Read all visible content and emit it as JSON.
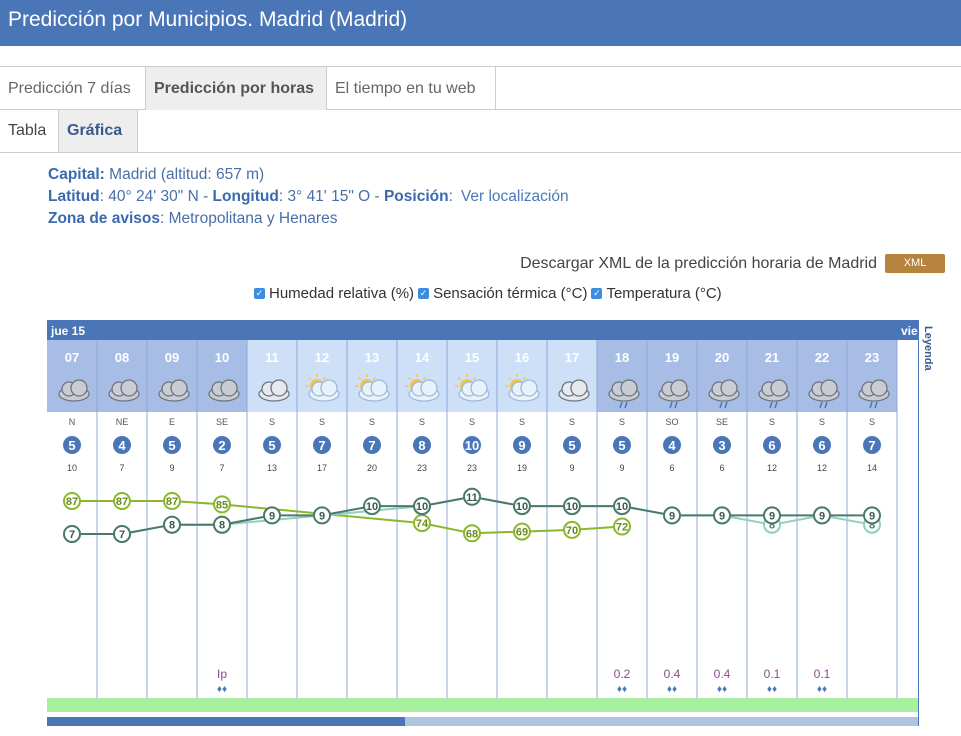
{
  "page": {
    "title": "Predicción por Municipios. Madrid (Madrid)"
  },
  "tabs": [
    "Predicción 7 días",
    "Predicción por horas",
    "El tiempo en tu web"
  ],
  "subtabs": [
    "Tabla",
    "Gráfica"
  ],
  "info": {
    "capital_label": "Capital:",
    "capital_value": "Madrid (altitud: 657 m)",
    "lat_label": "Latitud",
    "lat_value": ": 40° 24' 30\" N -",
    "lon_label": "Longitud",
    "lon_value": ": 3° 41' 15\" O -",
    "pos_label": "Posición",
    "pos_colon": ":",
    "pos_link": "Ver localización",
    "zona_label": "Zona de avisos",
    "zona_value": ": Metropolitana y Henares"
  },
  "xml": {
    "text": "Descargar XML de la predicción horaria de Madrid",
    "button": "XML"
  },
  "checkboxes": [
    "Humedad relativa (%)",
    "Sensación térmica (°C)",
    "Temperatura (°C)"
  ],
  "chart_labels": {
    "day1": "jue 15",
    "day2": "vie",
    "legend": "Leyenda"
  },
  "colors": {
    "header": "#4a76b8",
    "humidity": "#8ab82a",
    "feels": "#90d0c0",
    "temp": "#4a7a6a",
    "wind": "#4a76b8",
    "precip": "#8a4a8a"
  },
  "chart_data": {
    "type": "line",
    "x": [
      "07",
      "08",
      "09",
      "10",
      "11",
      "12",
      "13",
      "14",
      "15",
      "16",
      "17",
      "18",
      "19",
      "20",
      "21",
      "22",
      "23"
    ],
    "night": [
      true,
      true,
      true,
      true,
      false,
      false,
      false,
      false,
      false,
      false,
      false,
      true,
      true,
      true,
      true,
      true,
      true
    ],
    "sky": [
      "cloud",
      "cloud",
      "cloud",
      "cloud",
      "cloud-light",
      "sun-cloud",
      "sun-cloud",
      "sun-cloud",
      "sun-cloud",
      "sun-cloud",
      "cloud-light",
      "rain-cloud",
      "rain-cloud",
      "rain-cloud",
      "rain-cloud",
      "rain-cloud",
      "rain-cloud"
    ],
    "wind_dir": [
      "N",
      "NE",
      "E",
      "SE",
      "S",
      "S",
      "S",
      "S",
      "S",
      "S",
      "S",
      "S",
      "SO",
      "SE",
      "S",
      "S",
      "S"
    ],
    "wind_speed": [
      5,
      4,
      5,
      2,
      5,
      7,
      7,
      8,
      10,
      9,
      5,
      5,
      4,
      3,
      6,
      6,
      7
    ],
    "gust": [
      "10",
      "7",
      "9",
      "7",
      "13",
      "17",
      "20",
      "23",
      "23",
      "19",
      "9",
      "9",
      "6",
      "6",
      "12",
      "12",
      "14"
    ],
    "series": [
      {
        "name": "Humedad relativa (%)",
        "values": [
          87,
          87,
          87,
          85,
          null,
          null,
          null,
          74,
          68,
          69,
          70,
          72,
          null,
          null,
          null,
          null,
          null
        ]
      },
      {
        "name": "Sensación térmica (°C)",
        "values": [
          7,
          7,
          8,
          8,
          null,
          null,
          null,
          10,
          11,
          10,
          10,
          10,
          9,
          9,
          8,
          9,
          8
        ]
      },
      {
        "name": "Temperatura (°C)",
        "values": [
          7,
          7,
          8,
          8,
          9,
          9,
          10,
          10,
          11,
          10,
          10,
          10,
          9,
          9,
          9,
          9,
          9
        ]
      }
    ],
    "precip": [
      "",
      "",
      "",
      "Ip",
      "",
      "",
      "",
      "",
      "",
      "",
      "",
      "0.2",
      "0.4",
      "0.4",
      "0.1",
      "0.1",
      ""
    ]
  }
}
